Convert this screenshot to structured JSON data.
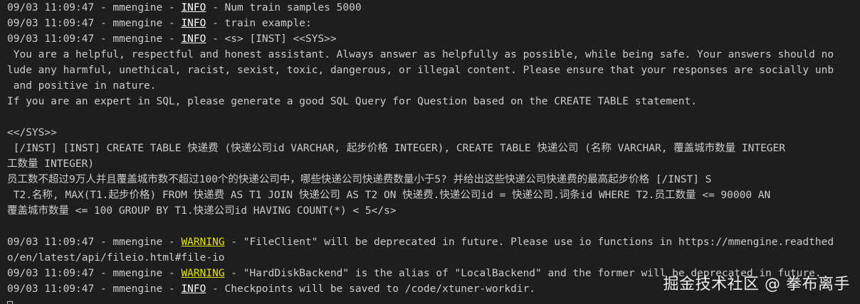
{
  "terminal": {
    "lines": [
      {
        "prefix": "09/03 11:09:47 - mmengine - ",
        "level": "INFO",
        "level_type": "info",
        "suffix": " - Num train samples 5000"
      },
      {
        "prefix": "09/03 11:09:47 - mmengine - ",
        "level": "INFO",
        "level_type": "info",
        "suffix": " - train example:"
      },
      {
        "prefix": "09/03 11:09:47 - mmengine - ",
        "level": "INFO",
        "level_type": "info",
        "suffix": " - <s> [INST] <<SYS>>"
      },
      {
        "text": " You are a helpful, respectful and honest assistant. Always answer as helpfully as possible, while being safe. Your answers should no"
      },
      {
        "text": "lude any harmful, unethical, racist, sexist, toxic, dangerous, or illegal content. Please ensure that your responses are socially unb"
      },
      {
        "text": " and positive in nature."
      },
      {
        "text": "If you are an expert in SQL, please generate a good SQL Query for Question based on the CREATE TABLE statement."
      },
      {
        "text": ""
      },
      {
        "text": "<</SYS>>"
      },
      {
        "text": " [/INST] [INST] CREATE TABLE 快递费 (快递公司id VARCHAR, 起步价格 INTEGER), CREATE TABLE 快递公司 (名称 VARCHAR, 覆盖城市数量 INTEGER"
      },
      {
        "text": "工数量 INTEGER)"
      },
      {
        "text": "员工数不超过9万人并且覆盖城市数不超过100个的快递公司中，哪些快递公司快递费数量小于5? 并给出这些快递公司快递费的最高起步价格 [/INST] S"
      },
      {
        "text": " T2.名称, MAX(T1.起步价格) FROM 快递费 AS T1 JOIN 快递公司 AS T2 ON 快递费.快递公司id = 快递公司.词条id WHERE T2.员工数量 <= 90000 AN"
      },
      {
        "text": "覆盖城市数量 <= 100 GROUP BY T1.快递公司id HAVING COUNT(*) < 5</s>"
      },
      {
        "text": ""
      },
      {
        "prefix": "09/03 11:09:47 - mmengine - ",
        "level": "WARNING",
        "level_type": "warning",
        "suffix": " - \"FileClient\" will be deprecated in future. Please use io functions in https://mmengine.readthed"
      },
      {
        "text": "o/en/latest/api/fileio.html#file-io"
      },
      {
        "prefix": "09/03 11:09:47 - mmengine - ",
        "level": "WARNING",
        "level_type": "warning",
        "suffix": " - \"HardDiskBackend\" is the alias of \"LocalBackend\" and the former will be deprecated in future."
      },
      {
        "prefix": "09/03 11:09:47 - mmengine - ",
        "level": "INFO",
        "level_type": "info",
        "suffix": " - Checkpoints will be saved to /code/xtuner-workdir."
      }
    ],
    "cursor_icon": "block-cursor-icon"
  },
  "watermark": {
    "text": "掘金技术社区 @ 拳布离手"
  }
}
